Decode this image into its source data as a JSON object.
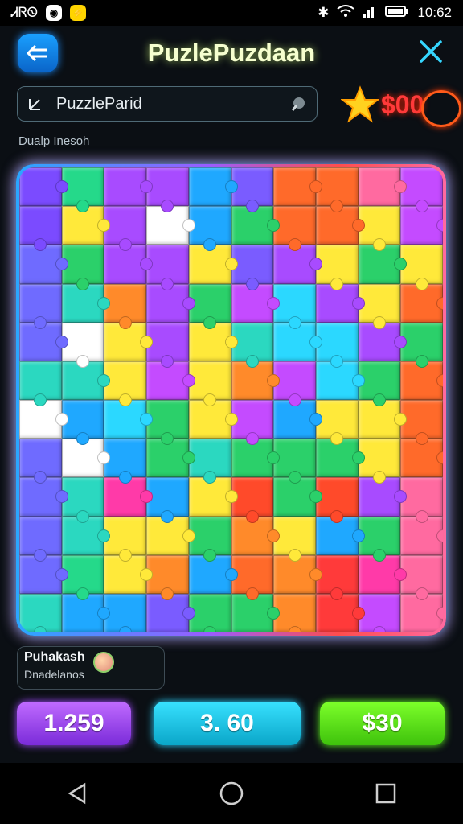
{
  "status_bar": {
    "left_text": "ᏗᏒᏫ",
    "time": "10:62"
  },
  "header": {
    "title": "PuzlePuzdaan"
  },
  "search": {
    "value": "PuzzleParid"
  },
  "coins": {
    "value": "$00"
  },
  "board": {
    "subtitle": "Dualp Inesoh"
  },
  "player": {
    "name": "Puhakash",
    "sub": "Dnadelanos"
  },
  "buttons": [
    {
      "label": "1.259",
      "color": "#9b45f0"
    },
    {
      "label": "3. 60",
      "color": "#18c4e6"
    },
    {
      "label": "$30",
      "color": "#59e01a"
    }
  ],
  "piece_colors": [
    [
      "#7b4bff",
      "#25d98a",
      "#a84bff",
      "#a84bff",
      "#1fa8ff",
      "#7a5cff",
      "#ff6a2a",
      "#ff6a2a",
      "#ff6aa0",
      "#c44bff"
    ],
    [
      "#7b4bff",
      "#ffe93a",
      "#a84bff",
      "#ffffff",
      "#1fa8ff",
      "#2bd06a",
      "#ff6a2a",
      "#ff6a2a",
      "#ffe93a",
      "#c44bff"
    ],
    [
      "#6f6bff",
      "#2bd06a",
      "#a84bff",
      "#a84bff",
      "#ffe93a",
      "#7a5cff",
      "#a84bff",
      "#ffe93a",
      "#2bd06a",
      "#ffe93a"
    ],
    [
      "#6f6bff",
      "#2bd8c0",
      "#ff8a2a",
      "#a84bff",
      "#2bd06a",
      "#c44bff",
      "#2bd8ff",
      "#a84bff",
      "#ffe93a",
      "#ff6a2a"
    ],
    [
      "#6f6bff",
      "#ffffff",
      "#ffe93a",
      "#a84bff",
      "#ffe93a",
      "#2bd8c0",
      "#2bd8ff",
      "#2bd8ff",
      "#a84bff",
      "#2bd06a"
    ],
    [
      "#2bd8c0",
      "#2bd8c0",
      "#ffe93a",
      "#c44bff",
      "#ffe93a",
      "#ff8a2a",
      "#c44bff",
      "#2bd8ff",
      "#2bd06a",
      "#ff6a2a"
    ],
    [
      "#ffffff",
      "#1fa8ff",
      "#2bd8ff",
      "#2bd06a",
      "#ffe93a",
      "#c44bff",
      "#1fa8ff",
      "#ffe93a",
      "#ffe93a",
      "#ff6a2a"
    ],
    [
      "#6f6bff",
      "#ffffff",
      "#1fa8ff",
      "#2bd06a",
      "#2bd8c0",
      "#2bd06a",
      "#2bd06a",
      "#2bd06a",
      "#ffe93a",
      "#ff6a2a"
    ],
    [
      "#6f6bff",
      "#2bd8c0",
      "#ff3aa8",
      "#1fa8ff",
      "#ffe93a",
      "#ff4a2a",
      "#2bd06a",
      "#ff4a2a",
      "#a84bff",
      "#ff6aa0"
    ],
    [
      "#6f6bff",
      "#2bd8c0",
      "#ffe93a",
      "#ffe93a",
      "#2bd06a",
      "#ff8a2a",
      "#ffe93a",
      "#1fa8ff",
      "#2bd06a",
      "#ff6aa0"
    ],
    [
      "#6f6bff",
      "#25d98a",
      "#ffe93a",
      "#ff8a2a",
      "#1fa8ff",
      "#ff6a2a",
      "#ff8a2a",
      "#ff3a3a",
      "#ff3aa8",
      "#ff6aa0"
    ],
    [
      "#2bd8c0",
      "#1fa8ff",
      "#1fa8ff",
      "#7a5cff",
      "#2bd06a",
      "#2bd06a",
      "#ff8a2a",
      "#ff3a3a",
      "#c44bff",
      "#ff6aa0"
    ]
  ]
}
